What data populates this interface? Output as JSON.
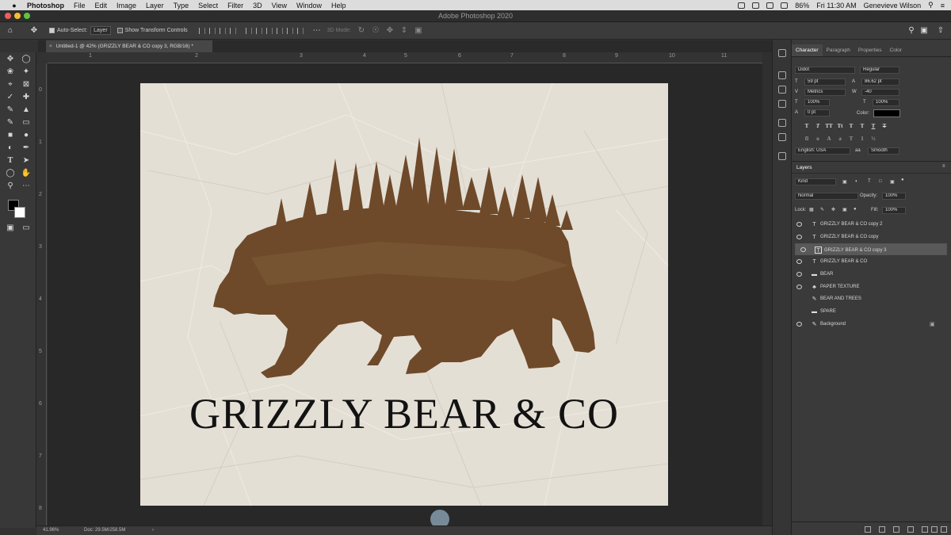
{
  "menubar": {
    "app": "Photoshop",
    "items": [
      "File",
      "Edit",
      "Image",
      "Layer",
      "Type",
      "Select",
      "Filter",
      "3D",
      "View",
      "Window",
      "Help"
    ],
    "battery": "86%",
    "datetime": "Fri 11:30 AM",
    "user": "Genevieve Wilson"
  },
  "window": {
    "title": "Adobe Photoshop 2020"
  },
  "options": {
    "auto_select_label": "Auto-Select:",
    "auto_select_value": "Layer",
    "transform_label": "Show Transform Controls",
    "mode_label": "3D Mode:"
  },
  "document": {
    "tab_title": "Untitled-1 @ 42% (GRIZZLY BEAR & CO copy 3, RGB/16) *",
    "artwork_text": "GRIZZLY BEAR & CO"
  },
  "rulers": {
    "h": [
      "1",
      "2",
      "3",
      "4",
      "5",
      "6",
      "7",
      "8",
      "9",
      "10",
      "11"
    ],
    "v": [
      "0",
      "1",
      "2",
      "3",
      "4",
      "5",
      "6",
      "7",
      "8"
    ]
  },
  "status": {
    "zoom": "41.96%",
    "doc": "Doc: 29.5M/258.5M"
  },
  "character": {
    "tabs": [
      "Character",
      "Paragraph",
      "Properties",
      "Color"
    ],
    "font_family": "Didot",
    "font_style": "Regular",
    "font_size": "59 pt",
    "leading": "86.62 pt",
    "kerning": "Metrics",
    "tracking": "-40",
    "vscale": "100%",
    "hscale": "100%",
    "baseline": "0 pt",
    "color_label": "Color:",
    "language": "English: USA",
    "aa_label": "aa",
    "aa_value": "Smooth",
    "color": "#000000"
  },
  "layers": {
    "title": "Layers",
    "filter": "Kind",
    "blend": "Normal",
    "opacity_label": "Opacity:",
    "opacity": "100%",
    "lock_label": "Lock:",
    "fill_label": "Fill:",
    "fill": "100%",
    "items": [
      {
        "name": "GRIZZLY BEAR & CO copy 2",
        "kind": "T",
        "visible": true
      },
      {
        "name": "GRIZZLY BEAR & CO copy",
        "kind": "T",
        "visible": true
      },
      {
        "name": "GRIZZLY BEAR & CO copy 3",
        "kind": "T",
        "visible": true,
        "selected": true
      },
      {
        "name": "GRIZZLY BEAR & CO",
        "kind": "T",
        "visible": true
      },
      {
        "name": "BEAR",
        "kind": "folder",
        "visible": true
      },
      {
        "name": "PAPER TEXTURE",
        "kind": "smart",
        "visible": true
      },
      {
        "name": "BEAR AND TREES",
        "kind": "brush",
        "visible": false
      },
      {
        "name": "SPARE",
        "kind": "folder",
        "visible": false
      },
      {
        "name": "Background",
        "kind": "brush",
        "visible": true,
        "locked": true
      }
    ]
  },
  "colors": {
    "bear": "#6e4a2a",
    "paper": "#e4dfd5"
  }
}
